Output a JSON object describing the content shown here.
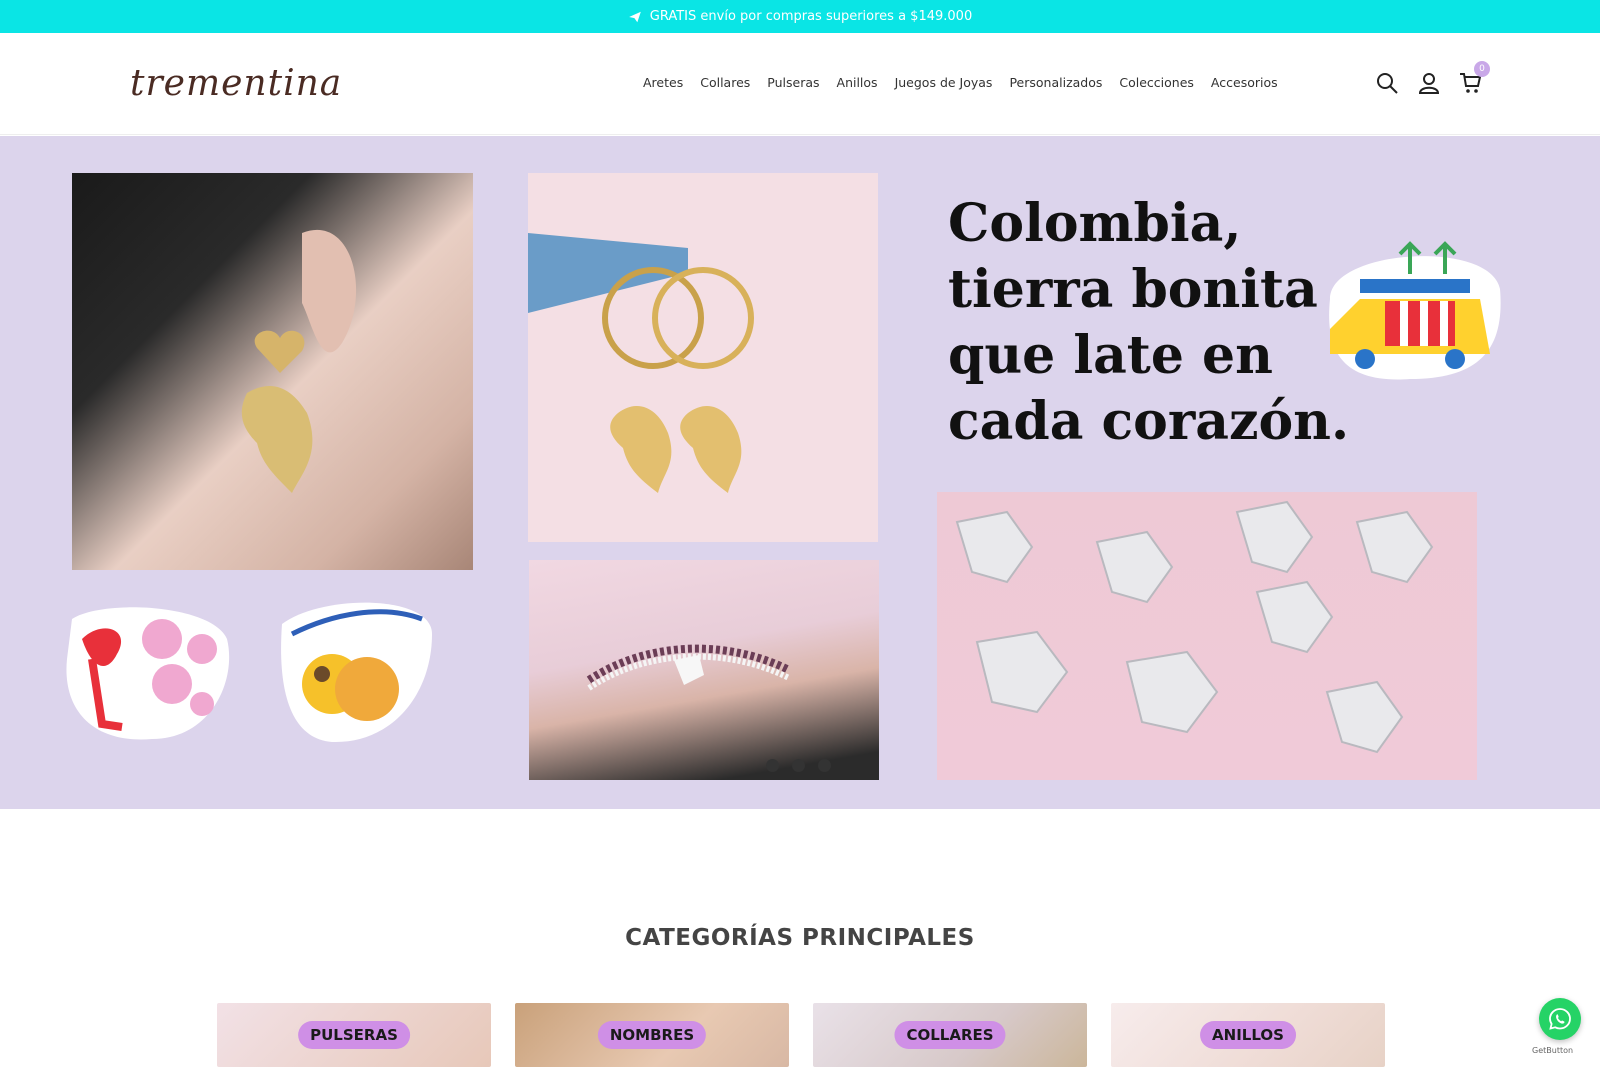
{
  "promo": {
    "text": "GRATIS envío por compras superiores a $149.000",
    "icon": "paper-plane-icon",
    "bg": "#0ae5e5"
  },
  "header": {
    "logo": "trementina",
    "nav": [
      "Aretes",
      "Collares",
      "Pulseras",
      "Anillos",
      "Juegos de Joyas",
      "Personalizados",
      "Colecciones",
      "Accesorios"
    ],
    "cart_count": "0"
  },
  "hero": {
    "title_lines": [
      "Colombia,",
      "tierra bonita",
      "que late en",
      "cada corazón."
    ],
    "bg": "#dcd4ec",
    "slides": 3
  },
  "categories": {
    "title": "CATEGORÍAS PRINCIPALES",
    "items": [
      "PULSERAS",
      "NOMBRES",
      "COLLARES",
      "ANILLOS"
    ]
  },
  "whatsapp": {
    "label": "GetButton"
  }
}
